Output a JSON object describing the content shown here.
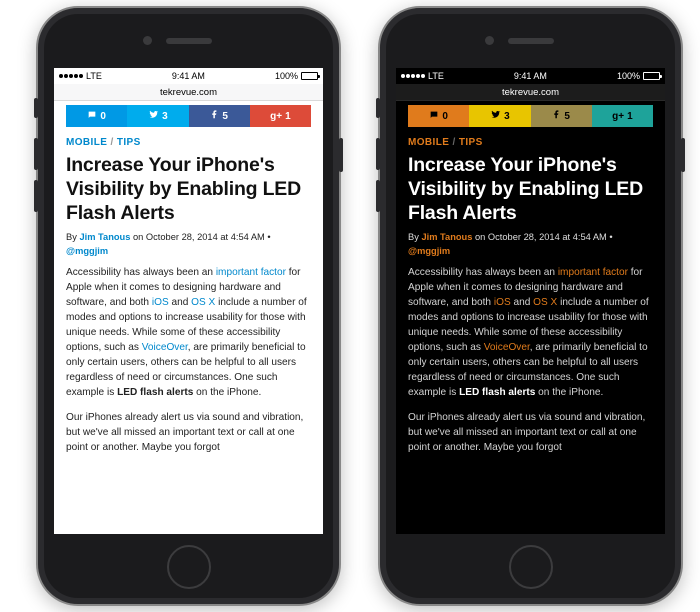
{
  "status": {
    "carrier": "LTE",
    "time": "9:41 AM",
    "battery_pct": "100%"
  },
  "url": "tekrevue.com",
  "social": {
    "comments": "0",
    "twitter": "3",
    "facebook": "5",
    "gplus": "1"
  },
  "breadcrumb": {
    "cat1": "MOBILE",
    "sep": "/",
    "cat2": "TIPS"
  },
  "headline": "Increase Your iPhone's Visibility by Enabling LED Flash Alerts",
  "byline": {
    "prefix": "By ",
    "author": "Jim Tanous",
    "mid": " on October 28, 2014 at 4:54 AM • ",
    "handle": "@mggjim"
  },
  "body": {
    "p1a": "Accessibility has always been an ",
    "p1l1": "important factor",
    "p1b": " for Apple when it comes to designing hardware and software, and both ",
    "p1l2": "iOS",
    "p1c": " and ",
    "p1l3": "OS X",
    "p1d": " include a number of modes and options to increase usability for those with unique needs. While some of these accessibility options, such as ",
    "p1l4": "VoiceOver",
    "p1e": ", are primarily beneficial to only certain users, others can be helpful to all users regardless of need or circumstances. One such example is ",
    "p1bold": "LED flash alerts",
    "p1f": " on the iPhone.",
    "p2": "Our iPhones already alert us via sound and vibration, but we've all missed an important text or call at one point or another. Maybe you forgot"
  },
  "icons": {
    "comment": "comment-icon",
    "twitter": "twitter-icon",
    "facebook": "facebook-icon",
    "gplus": "gplus-icon"
  }
}
